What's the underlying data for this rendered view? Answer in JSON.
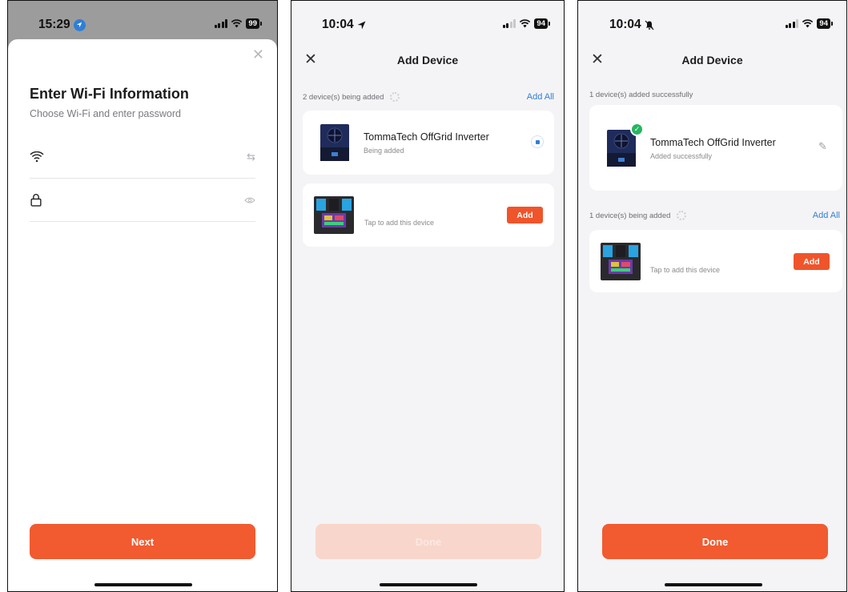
{
  "screen1": {
    "time": "15:29",
    "battery": "99",
    "close_icon": "close-icon",
    "title": "Enter Wi-Fi Information",
    "subtitle": "Choose Wi-Fi and enter password",
    "ssid_icon": "wifi-icon",
    "ssid_action_icon": "switch-network-icon",
    "password_icon": "lock-icon",
    "password_action_icon": "eye-icon",
    "next_label": "Next",
    "accent": "#f25a30"
  },
  "screen2": {
    "time": "10:04",
    "battery": "94",
    "title": "Add Device",
    "adding_status": "2 device(s) being added",
    "add_all_label": "Add All",
    "device1": {
      "name": "TommaTech OffGrid Inverter",
      "status": "Being added"
    },
    "device2": {
      "tap_text": "Tap to add this device",
      "add_label": "Add"
    },
    "done_label": "Done"
  },
  "screen3": {
    "time": "10:04",
    "battery": "94",
    "title": "Add Device",
    "success_status": "1 device(s) added successfully",
    "device1": {
      "name": "TommaTech OffGrid Inverter",
      "status": "Added successfully"
    },
    "adding_status": "1 device(s) being added",
    "add_all_label": "Add All",
    "device2": {
      "tap_text": "Tap to add this device",
      "add_label": "Add"
    },
    "done_label": "Done"
  },
  "colors": {
    "primary": "#f25a30",
    "link": "#2f7fd6",
    "success": "#26b562",
    "disabled_button": "#f9d6cb"
  }
}
